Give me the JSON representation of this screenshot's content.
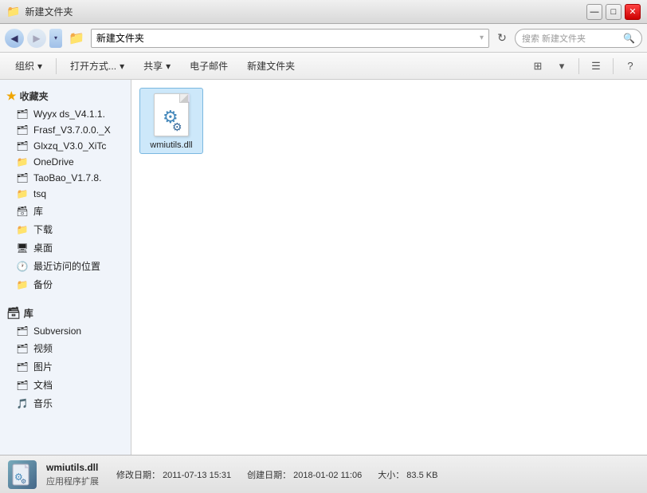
{
  "titleBar": {
    "title": "新建文件夹",
    "controls": {
      "minimize": "—",
      "maximize": "□",
      "close": "✕"
    }
  },
  "addressBar": {
    "path": "新建文件夹",
    "searchPlaceholder": "搜索 新建文件夹"
  },
  "toolbar": {
    "organize": "组织",
    "open": "打开方式...",
    "share": "共享",
    "email": "电子邮件",
    "newFolder": "新建文件夹",
    "viewDropdown": "▾",
    "helpBtn": "?"
  },
  "sidebar": {
    "favoritesHeader": "收藏夹",
    "favorites": [
      {
        "label": "Wyyx ds_V4.1.1.",
        "iconType": "stack"
      },
      {
        "label": "Frasf_V3.7.0.0._X",
        "iconType": "stack"
      },
      {
        "label": "Glxzq_V3.0_XiTc",
        "iconType": "stack"
      },
      {
        "label": "OneDrive",
        "iconType": "folder"
      },
      {
        "label": "TaoBao_V1.7.8.",
        "iconType": "stack"
      },
      {
        "label": "tsq",
        "iconType": "folder-yellow"
      },
      {
        "label": "库",
        "iconType": "library"
      },
      {
        "label": "下载",
        "iconType": "folder-blue"
      },
      {
        "label": "桌面",
        "iconType": "folder-blue"
      },
      {
        "label": "最近访问的位置",
        "iconType": "clock"
      },
      {
        "label": "备份",
        "iconType": "folder-yellow"
      }
    ],
    "libraryHeader": "库",
    "libraries": [
      {
        "label": "Subversion",
        "iconType": "library"
      },
      {
        "label": "视频",
        "iconType": "library"
      },
      {
        "label": "图片",
        "iconType": "library"
      },
      {
        "label": "文档",
        "iconType": "library"
      },
      {
        "label": "音乐",
        "iconType": "music"
      }
    ]
  },
  "fileArea": {
    "files": [
      {
        "name": "wmiutils.dll",
        "type": "dll"
      }
    ]
  },
  "statusBar": {
    "filename": "wmiutils.dll",
    "modifiedLabel": "修改日期：",
    "modifiedDate": "2011-07-13 15:31",
    "createdLabel": "创建日期：",
    "createdDate": "2018-01-02 11:06",
    "typeLabel": "应用程序扩展",
    "sizeLabel": "大小：",
    "size": "83.5 KB"
  }
}
